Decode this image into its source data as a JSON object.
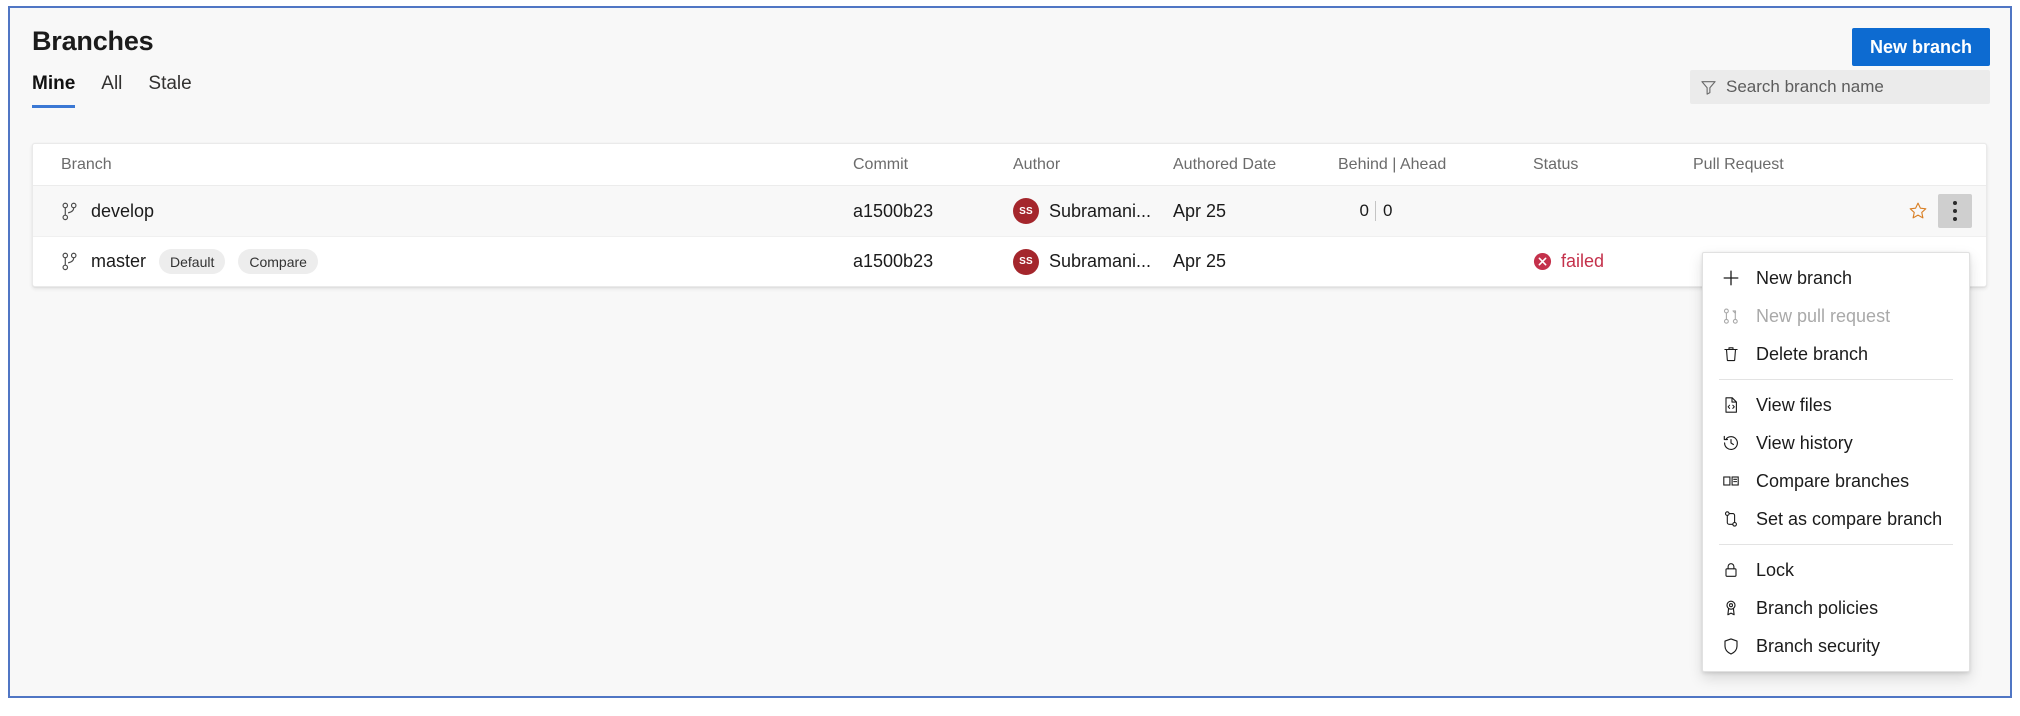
{
  "header": {
    "title": "Branches",
    "new_branch_label": "New branch"
  },
  "tabs": [
    {
      "label": "Mine",
      "selected": true
    },
    {
      "label": "All",
      "selected": false
    },
    {
      "label": "Stale",
      "selected": false
    }
  ],
  "search": {
    "placeholder": "Search branch name",
    "icon": "filter-icon"
  },
  "table": {
    "columns": [
      "Branch",
      "Commit",
      "Author",
      "Authored Date",
      "Behind | Ahead",
      "Status",
      "Pull Request"
    ],
    "rows": [
      {
        "branch": "develop",
        "badges": [],
        "commit": "a1500b23",
        "author": "Subramani...",
        "author_initials": "SS",
        "authored_date": "Apr 25",
        "behind": "0",
        "ahead": "0",
        "status": "",
        "pull_request": ""
      },
      {
        "branch": "master",
        "badges": [
          "Default",
          "Compare"
        ],
        "commit": "a1500b23",
        "author": "Subramani...",
        "author_initials": "SS",
        "authored_date": "Apr 25",
        "behind": "",
        "ahead": "",
        "status": "failed",
        "pull_request": ""
      }
    ]
  },
  "context_menu": {
    "groups": [
      [
        {
          "label": "New branch",
          "icon": "plus-icon",
          "disabled": false
        },
        {
          "label": "New pull request",
          "icon": "pull-request-icon",
          "disabled": true
        },
        {
          "label": "Delete branch",
          "icon": "trash-icon",
          "disabled": false
        }
      ],
      [
        {
          "label": "View files",
          "icon": "file-code-icon",
          "disabled": false
        },
        {
          "label": "View history",
          "icon": "history-icon",
          "disabled": false
        },
        {
          "label": "Compare branches",
          "icon": "compare-icon",
          "disabled": false
        },
        {
          "label": "Set as compare branch",
          "icon": "set-compare-icon",
          "disabled": false
        }
      ],
      [
        {
          "label": "Lock",
          "icon": "lock-icon",
          "disabled": false
        },
        {
          "label": "Branch policies",
          "icon": "policy-icon",
          "disabled": false
        },
        {
          "label": "Branch security",
          "icon": "shield-icon",
          "disabled": false
        }
      ]
    ]
  },
  "colors": {
    "accent": "#0d6bd1",
    "focus_border": "#5076c4",
    "tab_underline": "#3b78d4",
    "status_failed": "#c4314b",
    "avatar_bg": "#a4262c",
    "star": "#d98026"
  }
}
